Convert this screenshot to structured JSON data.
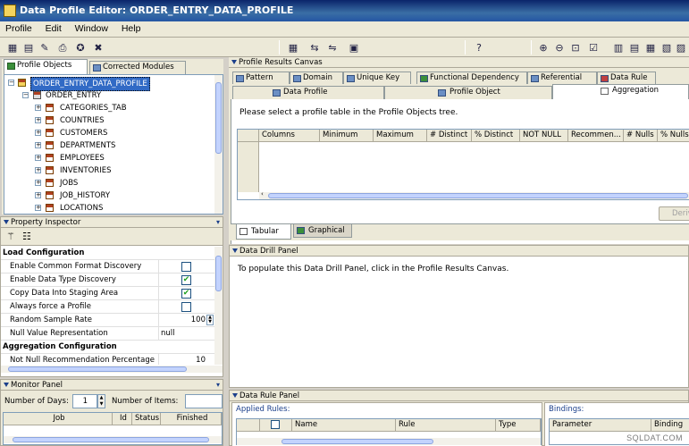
{
  "window": {
    "title": "Data Profile Editor: ORDER_ENTRY_DATA_PROFILE"
  },
  "menu": [
    "Profile",
    "Edit",
    "Window",
    "Help"
  ],
  "left_tabs": [
    "Profile Objects",
    "Corrected Modules"
  ],
  "tree": {
    "root": "ORDER_ENTRY_DATA_PROFILE",
    "module": "ORDER_ENTRY",
    "tables": [
      "CATEGORIES_TAB",
      "COUNTRIES",
      "CUSTOMERS",
      "DEPARTMENTS",
      "EMPLOYEES",
      "INVENTORIES",
      "JOBS",
      "JOB_HISTORY",
      "LOCATIONS"
    ]
  },
  "property_inspector": {
    "title": "Property Inspector",
    "load_section": "Load Configuration",
    "rows": [
      {
        "label": "Enable Common Format Discovery",
        "checked": false
      },
      {
        "label": "Enable Data Type Discovery",
        "checked": true
      },
      {
        "label": "Copy Data Into Staging Area",
        "checked": true
      },
      {
        "label": "Always force a Profile",
        "checked": false
      }
    ],
    "random_sample_label": "Random Sample Rate",
    "random_sample_value": "100",
    "null_repr_label": "Null Value Representation",
    "null_repr_value": "null",
    "agg_section": "Aggregation Configuration",
    "not_null_label": "Not Null Recommendation Percentage",
    "not_null_value": "10"
  },
  "monitor": {
    "title": "Monitor Panel",
    "days_label": "Number of Days:",
    "days_value": "1",
    "items_label": "Number of Items:",
    "items_value": "",
    "columns": [
      "Job",
      "Id",
      "Status",
      "Finished"
    ]
  },
  "results": {
    "title": "Profile Results Canvas",
    "tabs_row1": [
      "Pattern",
      "Domain",
      "Unique Key",
      "Functional Dependency",
      "Referential",
      "Data Rule"
    ],
    "tabs_row2": [
      "Data Profile",
      "Profile Object",
      "Aggregation"
    ],
    "message": "Please select a profile table in the Profile Objects tree.",
    "columns": [
      "Columns",
      "Minimum",
      "Maximum",
      "# Distinct",
      "% Distinct",
      "NOT NULL",
      "Recommen...",
      "# Nulls",
      "% Nulls"
    ],
    "bottom_tabs": [
      "Tabular",
      "Graphical"
    ],
    "derive_button": "Deriv"
  },
  "drill": {
    "title": "Data Drill Panel",
    "message": "To populate this Data Drill Panel, click in the Profile Results Canvas."
  },
  "rule_panel": {
    "title": "Data Rule Panel",
    "applied_label": "Applied Rules:",
    "columns": [
      "Name",
      "Rule",
      "Type"
    ],
    "bindings_label": "Bindings:",
    "binding_columns": [
      "Parameter",
      "Binding"
    ]
  },
  "watermark": "SQLDAT.COM"
}
